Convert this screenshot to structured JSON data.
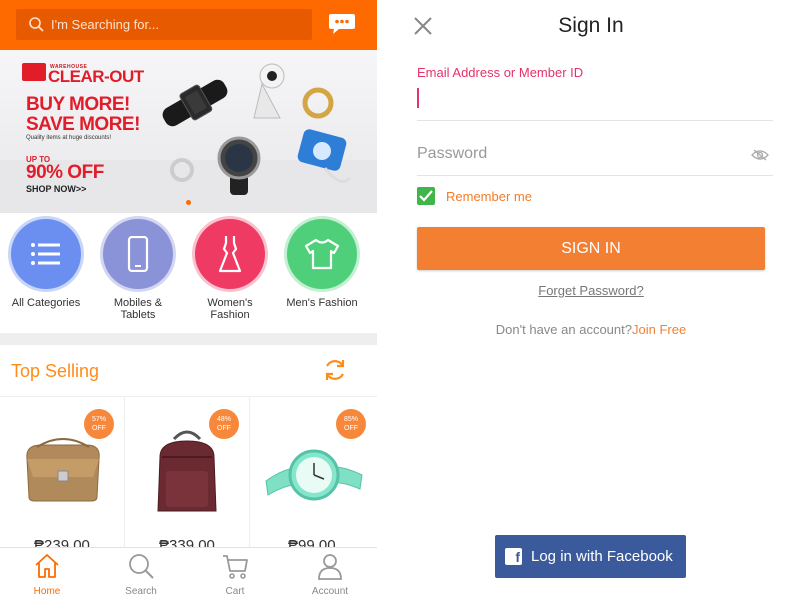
{
  "colors": {
    "brand_orange": "#ff6a00",
    "accent_pink": "#e4336a",
    "facebook_blue": "#3b5a9b",
    "check_green": "#41b44a"
  },
  "home": {
    "search": {
      "placeholder": "I'm Searching for...",
      "icon": "search-icon"
    },
    "chat_icon": "chat-icon",
    "banner": {
      "small_text": "WAREHOUSE",
      "headline": "CLEAR-OUT",
      "line1": "BUY MORE!",
      "line2": "SAVE MORE!",
      "sub": "Quality items at huge discounts!",
      "upto": "UP TO",
      "discount": "90% OFF",
      "cta": "SHOP NOW>>"
    },
    "categories": [
      {
        "label": "All Categories",
        "icon": "list-icon",
        "color": "#6b8ff0"
      },
      {
        "label": "Mobiles & Tablets",
        "icon": "phone-icon",
        "color": "#8a92d8"
      },
      {
        "label": "Women's Fashion",
        "icon": "dress-icon",
        "color": "#ef3a63"
      },
      {
        "label": "Men's Fashion",
        "icon": "tshirt-icon",
        "color": "#4fcf7a"
      }
    ],
    "top_selling": {
      "title": "Top Selling",
      "products": [
        {
          "badge_pct": "57%",
          "badge_off": "OFF",
          "price": "₱239.00"
        },
        {
          "badge_pct": "48%",
          "badge_off": "OFF",
          "price": "₱339.00"
        },
        {
          "badge_pct": "85%",
          "badge_off": "OFF",
          "price": "₱99.00"
        }
      ]
    },
    "nav": [
      {
        "label": "Home",
        "icon": "home-icon",
        "active": true
      },
      {
        "label": "Search",
        "icon": "search-icon"
      },
      {
        "label": "Cart",
        "icon": "cart-icon"
      },
      {
        "label": "Account",
        "icon": "user-icon"
      }
    ]
  },
  "signin": {
    "title": "Sign In",
    "email_label": "Email Address or Member ID",
    "password_placeholder": "Password",
    "remember_label": "Remember me",
    "signin_button": "SIGN IN",
    "forget_link": "Forget Password?",
    "no_account": "Don't have an account?",
    "join_link": "Join Free",
    "facebook_button": "Log in with Facebook"
  }
}
